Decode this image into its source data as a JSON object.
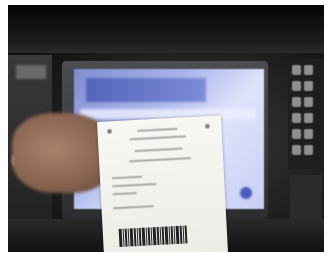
{
  "scene": {
    "subject": "voter-receipt-at-voting-machine"
  }
}
